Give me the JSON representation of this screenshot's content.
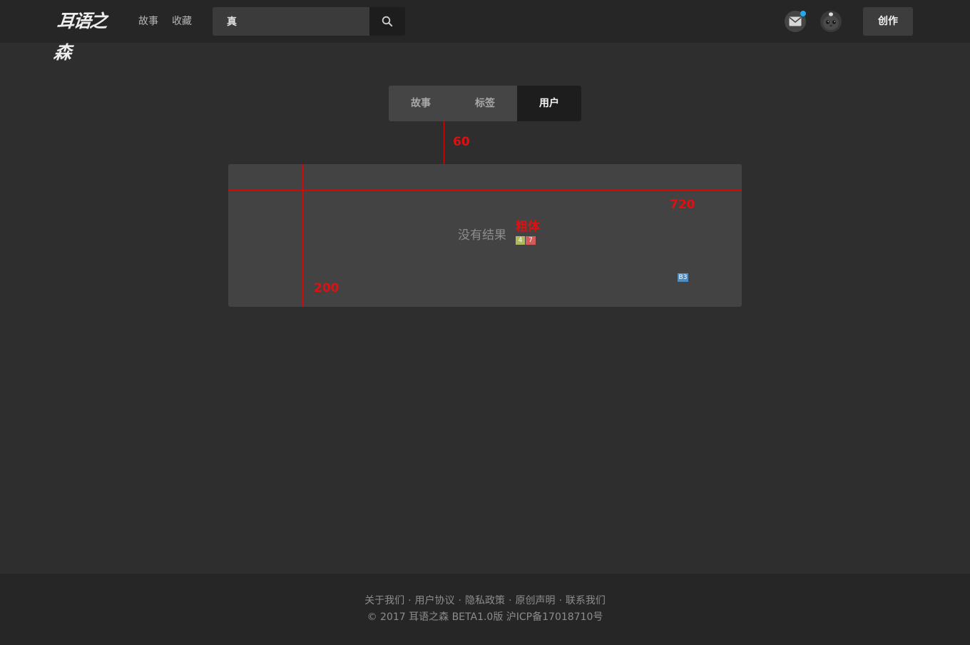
{
  "header": {
    "logo_text": "耳语之森",
    "nav": [
      {
        "label": "故事"
      },
      {
        "label": "收藏"
      }
    ],
    "search": {
      "value": "真"
    },
    "create_label": "创作",
    "mail_icon": "mail-icon",
    "search_icon": "search-icon",
    "notification_color": "#23a8f0"
  },
  "tabs": [
    {
      "label": "故事",
      "active": false
    },
    {
      "label": "标签",
      "active": false
    },
    {
      "label": "用户",
      "active": true
    }
  ],
  "results": {
    "empty_text": "没有结果"
  },
  "annotations": {
    "gap_label": "60",
    "width_label": "720",
    "height_label": "200",
    "font_label": "粗体",
    "chip_a": "4",
    "chip_b": "7",
    "chip_c": "B3",
    "color": "#e01010"
  },
  "footer": {
    "links": [
      {
        "label": "关于我们"
      },
      {
        "label": "用户协议"
      },
      {
        "label": "隐私政策"
      },
      {
        "label": "原创声明"
      },
      {
        "label": "联系我们"
      }
    ],
    "separator": "·",
    "copyright": "© 2017  耳语之森  BETA1.0版  沪ICP备17018710号"
  }
}
